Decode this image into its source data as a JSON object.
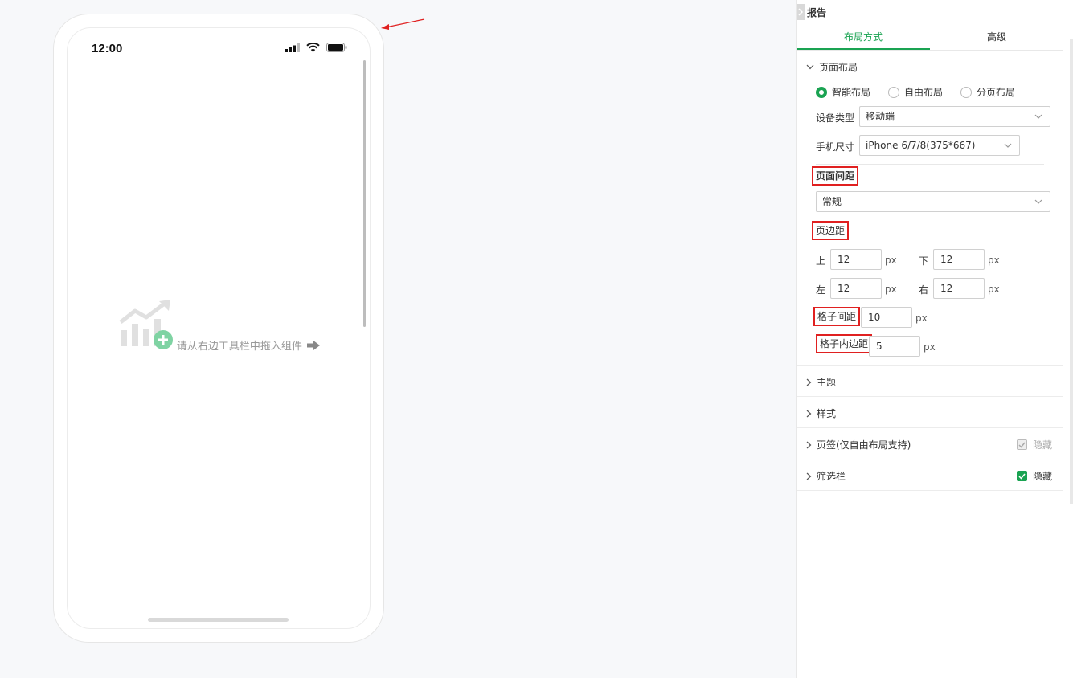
{
  "phone": {
    "time": "12:00",
    "empty_text": "请从右边工具栏中拖入组件"
  },
  "panel": {
    "title": "报告",
    "tabs": [
      {
        "label": "布局方式",
        "active": true
      },
      {
        "label": "高级",
        "active": false
      }
    ],
    "page_layout": {
      "section_label": "页面布局",
      "radios": [
        {
          "label": "智能布局",
          "selected": true
        },
        {
          "label": "自由布局",
          "selected": false
        },
        {
          "label": "分页布局",
          "selected": false
        }
      ],
      "device_type_label": "设备类型",
      "device_type_value": "移动端",
      "phone_size_label": "手机尺寸",
      "phone_size_value": "iPhone 6/7/8(375*667)",
      "page_spacing_label": "页面间距",
      "page_spacing_value": "常规",
      "margin_label": "页边距",
      "top_label": "上",
      "top_value": "12",
      "bottom_label": "下",
      "bottom_value": "12",
      "left_label": "左",
      "left_value": "12",
      "right_label": "右",
      "right_value": "12",
      "unit": "px",
      "grid_gap_label": "格子间距",
      "grid_gap_value": "10",
      "grid_padding_label": "格子内边距",
      "grid_padding_value": "5"
    },
    "sections": {
      "theme": "主题",
      "style": "样式",
      "tabs_section": "页签(仅自由布局支持)",
      "tabs_hide": "隐藏",
      "filter_bar": "筛选栏",
      "filter_hide": "隐藏"
    }
  },
  "colors": {
    "accent": "#1aa352",
    "annotation": "#e02020"
  }
}
